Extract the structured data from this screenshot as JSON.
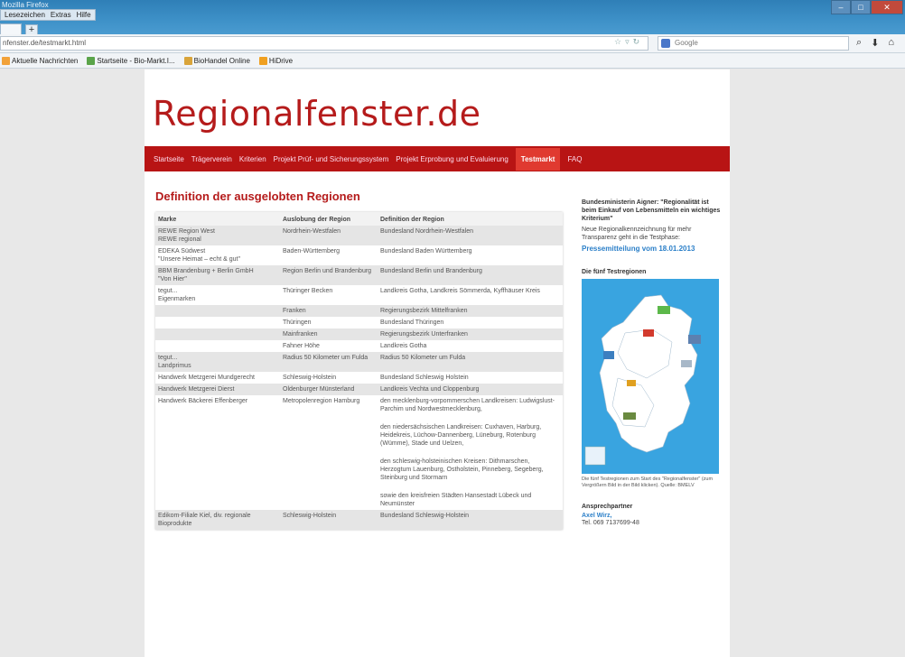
{
  "browser": {
    "window_title": "Mozilla Firefox",
    "menu": [
      "Lesezeichen",
      "Extras",
      "Hilfe"
    ],
    "new_tab_label": "+",
    "url": "nfenster.de/testmarkt.html",
    "search_placeholder": "Google",
    "bookmarks": [
      {
        "label": "Aktuelle Nachrichten",
        "color": "#f2a23a"
      },
      {
        "label": "Startseite - Bio-Markt.I...",
        "color": "#5aa44a"
      },
      {
        "label": "BioHandel Online",
        "color": "#d9a43a"
      },
      {
        "label": "HiDrive",
        "color": "#f0a020"
      }
    ]
  },
  "site": {
    "logo": "Regionalfenster.de",
    "nav": [
      {
        "label": "Startseite",
        "active": false
      },
      {
        "label": "Trägerverein",
        "active": false
      },
      {
        "label": "Kriterien",
        "active": false
      },
      {
        "label": "Projekt Prüf- und Sicherungssystem",
        "active": false
      },
      {
        "label": "Projekt Erprobung und Evaluierung",
        "active": false
      },
      {
        "label": "Testmarkt",
        "active": true
      },
      {
        "label": "FAQ",
        "active": false
      }
    ]
  },
  "main": {
    "title": "Definition der ausgelobten Regionen",
    "table": {
      "headers": [
        "Marke",
        "Auslobung der Region",
        "Definition der Region"
      ],
      "rows": [
        {
          "marke": [
            "REWE Region West",
            "REWE regional"
          ],
          "auslobung": [
            "Nordrhein-Westfalen"
          ],
          "definition": [
            "Bundesland Nordrhein-Westfalen"
          ]
        },
        {
          "marke": [
            "EDEKA Südwest",
            "\"Unsere Heimat – echt & gut\""
          ],
          "auslobung": [
            "Baden-Württemberg"
          ],
          "definition": [
            "Bundesland Baden Württemberg"
          ]
        },
        {
          "marke": [
            "BBM Brandenburg + Berlin GmbH",
            "\"Von Hier\""
          ],
          "auslobung": [
            "Region Berlin und Brandenburg"
          ],
          "definition": [
            "Bundesland Berlin und Brandenburg"
          ]
        },
        {
          "marke": [
            "tegut...",
            "Eigenmarken"
          ],
          "auslobung": [
            "Thüringer Becken"
          ],
          "definition": [
            "Landkreis Gotha, Landkreis Sömmerda, Kyffhäuser Kreis"
          ]
        },
        {
          "marke": [
            ""
          ],
          "auslobung": [
            "Franken"
          ],
          "definition": [
            "Regierungsbezirk Mittelfranken"
          ]
        },
        {
          "marke": [
            ""
          ],
          "auslobung": [
            "Thüringen"
          ],
          "definition": [
            "Bundesland Thüringen"
          ]
        },
        {
          "marke": [
            ""
          ],
          "auslobung": [
            "Mainfranken"
          ],
          "definition": [
            "Regierungsbezirk Unterfranken"
          ]
        },
        {
          "marke": [
            ""
          ],
          "auslobung": [
            "Fahner Höhe"
          ],
          "definition": [
            "Landkreis Gotha"
          ]
        },
        {
          "marke": [
            "tegut...",
            "Landprimus"
          ],
          "auslobung": [
            "Radius 50 Kilometer um Fulda"
          ],
          "definition": [
            "Radius 50 Kilometer um Fulda"
          ]
        },
        {
          "marke": [
            "Handwerk Metzgerei Mundgerecht"
          ],
          "auslobung": [
            "Schleswig-Holstein"
          ],
          "definition": [
            "Bundesland Schleswig Holstein"
          ]
        },
        {
          "marke": [
            "Handwerk Metzgerei Dierst"
          ],
          "auslobung": [
            "Oldenburger Münsterland"
          ],
          "definition": [
            "Landkreis Vechta und Cloppenburg"
          ]
        },
        {
          "marke": [
            "Handwerk Bäckerei Effenberger"
          ],
          "auslobung": [
            "Metropolenregion Hamburg"
          ],
          "definition": [
            "den mecklenburg-vorpommerschen Landkreisen: Ludwigslust-Parchim und Nordwestmecklenburg,",
            "den niedersächsischen Landkreisen: Cuxhaven, Harburg, Heidekreis, Lüchow-Dannenberg, Lüneburg, Rotenburg (Wümme), Stade und Uelzen,",
            "den schleswig-holsteinischen Kreisen: Dithmarschen, Herzogtum Lauenburg, Ostholstein, Pinneberg, Segeberg, Steinburg und Stormarn",
            "sowie den kreisfreien Städten Hansestadt Lübeck und Neumünster"
          ]
        },
        {
          "marke": [
            "Edikom-Filiale Kiel, div. regionale Bioprodukte"
          ],
          "auslobung": [
            "Schleswig-Holstein"
          ],
          "definition": [
            "Bundesland Schleswig-Holstein"
          ]
        }
      ]
    }
  },
  "sidebar": {
    "quote": "Bundesministerin Aigner: \"Regionalität ist beim Einkauf von Lebensmitteln ein wichtiges Kriterium\"",
    "text": "Neue Regionalkennzeichnung für mehr Transparenz geht in die Testphase:",
    "press_link": "Pressemitteilung vom 18.01.2013",
    "map_title": "Die fünf Testregionen",
    "map_caption": "Die fünf Testregionen zum Start des \"Regionalfenster\" (zum Vergrößern Bild in der Bild klicken). Quelle: BMELV",
    "contact_title": "Ansprechpartner",
    "contact_name": "Axel Wirz,",
    "contact_phone": "Tel. 069 7137699-48",
    "colors": {
      "map_sea": "#39a4e0",
      "map_land": "#ffffff",
      "accent": "#b81414",
      "link": "#2b7fc8"
    }
  }
}
